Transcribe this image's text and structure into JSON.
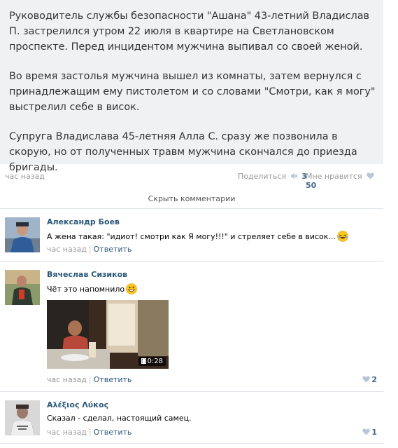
{
  "post": {
    "paragraphs": [
      "Руководитель службы безопасности \"Ашана\" 43-летний Владислав П. застрелился утром 22 июля в квартире на Светлановском проспекте. Перед инцидентом мужчина выпивал со своей женой.",
      "Во время застолья мужчина вышел из комнаты, затем вернулся с принадлежащим ему пистолетом и со словами \"Смотри, как я могу\" выстрелил себе в висок.",
      "Супруга Владислава 45-летняя Алла С. сразу же позвонила в скорую, но от полученных травм мужчина скончался до приезда бригады."
    ],
    "time": "час назад",
    "share_label": "Поделиться",
    "share_count": "3",
    "like_label": "Мне нравится",
    "like_count": "50",
    "hide_comments": "Скрыть комментарии"
  },
  "comments": [
    {
      "author": "Александр Боев",
      "text": "А жена такая: \"идиот! смотри как Я могу!!!\" и стреляет себе в висок...",
      "emoji": "laughing-emoji",
      "time": "час назад",
      "reply": "Ответить",
      "likes": ""
    },
    {
      "author": "Вячеслав Сизиков",
      "text": "Чёт это напомнило",
      "emoji": "grinning-emoji",
      "time": "час назад",
      "reply": "Ответить",
      "likes": "2",
      "video_duration": "0:28"
    },
    {
      "author": "Αλέξιος Λύκος",
      "text": "Сказал - сделал, настоящий самец.",
      "time": "час назад",
      "reply": "Ответить",
      "likes": "1"
    }
  ],
  "colors": {
    "post_bg": "#f0f1f3",
    "link": "#2b587a",
    "muted": "#999999",
    "divider": "#dfe4ea"
  }
}
